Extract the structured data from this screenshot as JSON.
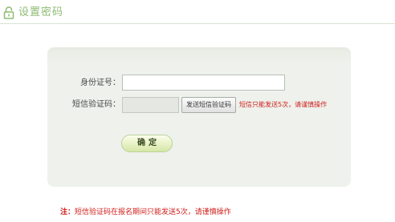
{
  "header": {
    "title": "设置密码",
    "icon": "lock-icon"
  },
  "form": {
    "id_number_label": "身份证号：",
    "id_number_value": "",
    "sms_code_label": "短信验证码：",
    "sms_code_value": "",
    "send_button_label": "发送短信验证码",
    "sms_tip": "短信只能发送5次，请谨慎操作",
    "confirm_button_label": "确定"
  },
  "note": {
    "prefix": "注：",
    "text": "短信验证码在报名期间只能发送5次，请谨慎操作"
  },
  "colors": {
    "title": "#8dbb72",
    "panel": "#eef1ec",
    "warning": "#d0201c",
    "confirm_button": "#e7f1c4"
  }
}
